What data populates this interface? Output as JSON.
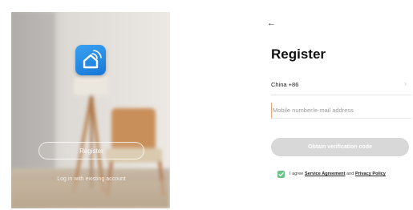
{
  "welcome": {
    "register_label": "Register",
    "login_label": "Log in with existing account"
  },
  "register": {
    "title": "Register",
    "country_code": "China +86",
    "phone_placeholder": "Mobile number/e-mail address",
    "obtain_label": "Obtain verification code",
    "agree_prefix": "I agree",
    "service_agreement": "Service Agreement",
    "and_text": "and",
    "privacy_policy": "Privacy Policy"
  },
  "colors": {
    "logo_blue": "#1f8ae8",
    "button_disabled": "#d8d8d8",
    "checkbox_green": "#6cc28a"
  }
}
